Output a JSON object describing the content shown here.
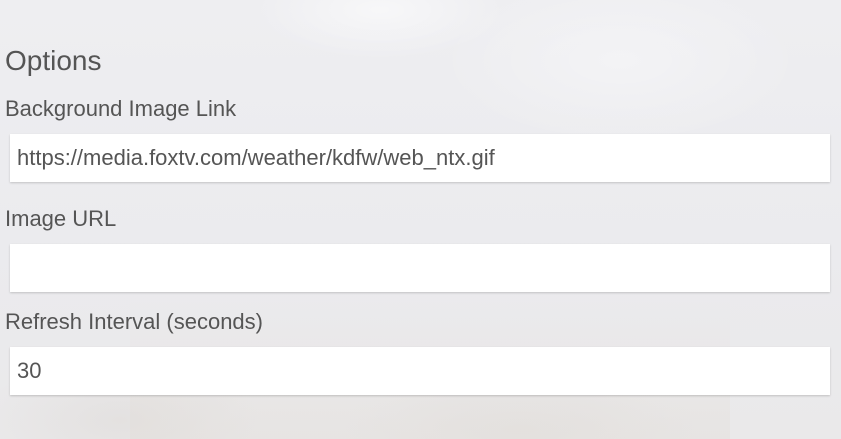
{
  "options": {
    "title": "Options",
    "fields": [
      {
        "label": "Background Image Link",
        "value": "https://media.foxtv.com/weather/kdfw/web_ntx.gif",
        "placeholder": ""
      },
      {
        "label": "Image URL",
        "value": "",
        "placeholder": ""
      },
      {
        "label": "Refresh Interval (seconds)",
        "value": "30",
        "placeholder": ""
      }
    ]
  }
}
